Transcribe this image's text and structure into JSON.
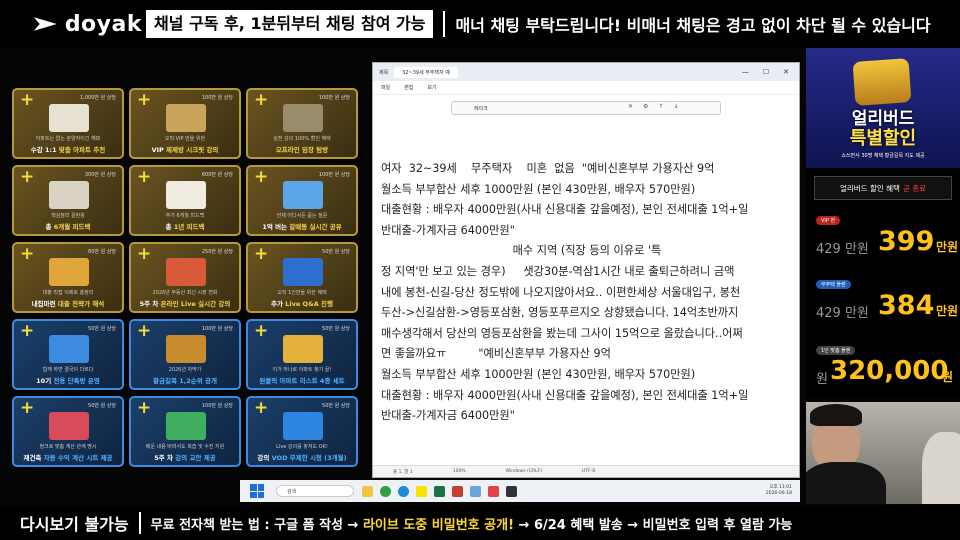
{
  "header": {
    "logo_text": "doyak",
    "notice_box": "채널 구독 후, 1분뒤부터 채팅 참여 가능",
    "notice_right": "매너 채팅 부탁드립니다! 비매너 채팅은 경고 없이 차단 될 수 있습니다"
  },
  "benefits": [
    {
      "price": "1,000만 원 상당",
      "sub": "아파트는 없는 분양자이긴 해봐",
      "title_a": "수강 1:1 ",
      "title_hl": "맞춤 아파트 추천",
      "title_b": "",
      "style": "gold",
      "icon": "apartment-report-icon"
    },
    {
      "price": "100만 원 상당",
      "sub": "오직 VIP 만을 위한",
      "title_a": "VIP ",
      "title_hl": "제제방 시크릿 강의",
      "title_b": "",
      "style": "gold",
      "icon": "vip-building-icon"
    },
    {
      "price": "100만 원 상당",
      "sub": "실전 강의 100% 할인 혜택",
      "title_a": "",
      "title_hl": "오프라인 임장 탐방",
      "title_b": "",
      "style": "gold",
      "icon": "field-trip-photo-icon"
    },
    {
      "price": "300만 원 상당",
      "sub": "핵심정리 끝판왕",
      "title_a": "총 ",
      "title_hl": "6개월 피드백",
      "title_b": "",
      "style": "gold",
      "icon": "documents-icon"
    },
    {
      "price": "600만 원 상당",
      "sub": "추가 6개월 피드백",
      "title_a": "총 ",
      "title_hl": "1년 피드백",
      "title_b": "",
      "style": "gold",
      "icon": "mentor-avatar-icon"
    },
    {
      "price": "100만 원 상당",
      "sub": "언제 어디서든 묻는 질문",
      "title_a": "1억 버는 ",
      "title_hl": "갈매동 실시간 공유",
      "title_b": "",
      "style": "gold",
      "icon": "chat-bubbles-icon"
    },
    {
      "price": "80만 원 상당",
      "sub": "대출 직접 이제로 총정리",
      "title_a": "내집마련 ",
      "title_hl": "대출 전략가 해석",
      "title_b": "",
      "style": "gold",
      "icon": "book-icon"
    },
    {
      "price": "250만 원 상당",
      "sub": "2026년 부동산 최신 시장 변화",
      "title_a": "5주 차 ",
      "title_hl": "온라인 Live 실시간 강의",
      "title_b": "",
      "style": "gold",
      "icon": "calendar-icon"
    },
    {
      "price": "50만 원 상당",
      "sub": "오직 1인만을 위한 혜택",
      "title_a": "추가 ",
      "title_hl": "Live Q&A 진행",
      "title_b": "",
      "style": "gold",
      "icon": "question-mark-icon"
    },
    {
      "price": "50만 원 상당",
      "sub": "함께 하면 결국이 다르다",
      "title_a": "10기 ",
      "title_hl": "전용 단톡방 운영",
      "title_b": "",
      "style": "blue",
      "icon": "group-chat-icon"
    },
    {
      "price": "100만 원 상당",
      "sub": "2026년 자막가",
      "title_a": "",
      "title_hl": "황금길목 1,2순위 공개",
      "title_b": "",
      "style": "blue",
      "icon": "treasure-chest-icon"
    },
    {
      "price": "50만 원 상당",
      "sub": "이거 하나로 아파트 찾기 끝!",
      "title_a": "",
      "title_hl": "원클릭 아파트 리스트 4종 세트",
      "title_b": "",
      "style": "blue",
      "icon": "folder-icon"
    },
    {
      "price": "50만 원 상당",
      "sub": "청크로 맞춤 계산 관계 명시",
      "title_a": "재건축 ",
      "title_hl": "자동 수익 계산 시트 제공",
      "title_b": "",
      "style": "blue",
      "icon": "calculator-phone-icon"
    },
    {
      "price": "100만 원 상당",
      "sub": "배운 내용 버려서도 복습 및 수진 지원",
      "title_a": "5주 차 ",
      "title_hl": "강의 교안 제공",
      "title_b": "",
      "style": "blue",
      "icon": "binders-icon"
    },
    {
      "price": "50만 원 상당",
      "sub": "Live 강의를 놓쳐도 OK!",
      "title_a": "강의 ",
      "title_hl": "VOD 무제한 시청 (3개월)",
      "title_b": "",
      "style": "blue",
      "icon": "video-camera-icon"
    }
  ],
  "notepad": {
    "tab_title": "32~39세 무주택자 예",
    "app_label": "제목",
    "menu": [
      "파일",
      "편집",
      "보기"
    ],
    "find_value": "레이크",
    "status": [
      "줄 1, 열 1",
      "100%",
      "Windows (CRLF)",
      "UTF-8"
    ],
    "lines": [
      "여자  32~39세    무주택자    미혼  없음  \"예비신혼부부 가용자산 9억",
      "월소득 부부합산 세후 1000만원 (본인 430만원, 배우자 570만원)",
      "대출현황 : 배우자 4000만원(사내 신용대출 갚을예정), 본인 전세대출 1억+일",
      "반대출-가계자금 6400만원\"",
      "                                     매수 지역 (직장 등의 이유로 '특",
      "정 지역'만 보고 있는 경우)     샛강30분-역삼1시간 내로 출퇴근하려니 금액",
      "내에 봉천-신길-당산 정도밖에 나오지않아서요.. 이편한세상 서울대입구, 봉천",
      "두산->신길삼환->영등포삼환, 영등포푸르지오 상향됐습니다. 14억초반까지",
      "매수생각해서 당산의 영등포삼환을 봤는데 그사이 15억으로 올랐습니다..어쩌",
      "면 좋을까요ㅠ         \"예비신혼부부 가용자산 9억",
      "월소득 부부합산 세후 1000만원 (본인 430만원, 배우자 570만원)",
      "대출현황 : 배우자 4000만원(사내 신용대출 갚을예정), 본인 전세대출 1억+일",
      "반대출-가계자금 6400만원\""
    ]
  },
  "taskbar": {
    "search_placeholder": "검색",
    "time": "오후 11:01",
    "date": "2026-06-18"
  },
  "promo": {
    "ad_title_1": "얼리버드",
    "ad_title_2": "특별할인",
    "ad_note": "쇼쓰면서 30명 혜택 황금길목 지도 제공",
    "early_bird_label": "얼리버드 할인 혜택",
    "early_bird_red": "곧 종료",
    "tiers": [
      {
        "label": "VIP 반",
        "original": "429 만원",
        "price": "399",
        "unit": "만원",
        "pill_color": "#b7261f"
      },
      {
        "label": "무주택 플랜",
        "original": "429 만원",
        "price": "384",
        "unit": "만원",
        "pill_color": "#1e5fb8"
      },
      {
        "label": "1인 맞춤 플랜",
        "original": "원",
        "price": "320,000",
        "unit": "원",
        "pill_color": "#444"
      }
    ]
  },
  "footer": {
    "no_replay": "다시보기 불가능",
    "ticker_a": "무료 전자책 받는 법 : 구글 폼 작성 → ",
    "ticker_hl": "라이브 도중 비밀번호 공개!",
    "ticker_b": " → 6/24 혜택 발송 → 비밀번호 입력 후 열람 가능"
  },
  "colors": {
    "gold_border": "#b59a3d",
    "blue_border": "#3d8be0",
    "accent_yellow": "#ffc11a"
  }
}
